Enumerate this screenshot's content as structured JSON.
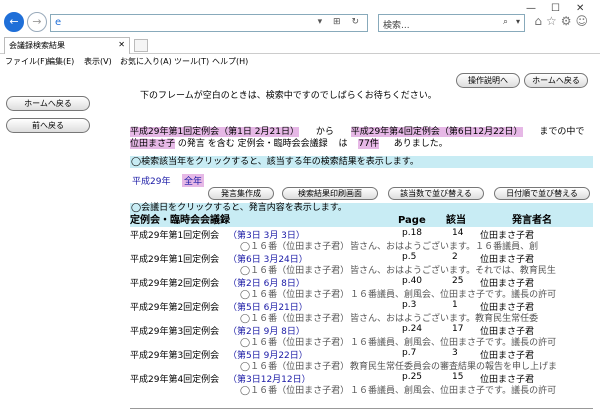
{
  "browser": {
    "search_placeholder": "検索...",
    "tab_title": "会議録検索結果",
    "menu": [
      "ファイル(F)",
      "編集(E)",
      "表示(V)",
      "お気に入り(A)",
      "ツール(T)",
      "ヘルプ(H)"
    ]
  },
  "buttons": {
    "home": "ホームへ戻る",
    "back": "前へ戻る",
    "help": "操作説明へ",
    "home_top": "ホームへ戻る",
    "speech_create": "発言集作成",
    "print": "検索結果印刷画面",
    "sort_by_no": "該当数で並び替える",
    "sort_by_date": "日付順で並び替える"
  },
  "notice": "下のフレームが空白のときは、検索中ですのでしばらくお待ちください。",
  "summary": {
    "range_from": "平成29年第1回定例会（第1日 2月21日）",
    "kara": "から",
    "range_to": "平成29年第4回定例会（第6日12月22日）",
    "made": "までの中で",
    "speaker": "位田まさ子",
    "text1": "の発言 を含む 定例会・臨時会会議録",
    "wa": "は",
    "count": "77件",
    "text2": "ありました。"
  },
  "year_bar": "◯検索該当年をクリックすると、該当する年の検索結果を表示します。",
  "year_links": [
    "平成29年",
    "全年"
  ],
  "day_bar": "◯会議日をクリックすると、発言内容を表示します。",
  "table": {
    "headers": [
      "定例会・臨時会会議録",
      "Page",
      "該当",
      "発言者名"
    ],
    "rows": [
      {
        "session": "平成29年第1回定例会",
        "date": "（第3日 3月 3日）",
        "page": "p.18",
        "no": "14",
        "speaker": "位田まさ子君",
        "who": "◯１６番（位田まさ子君）",
        "snippet": "皆さん、おはようございます。１６番議員、創"
      },
      {
        "session": "平成29年第1回定例会",
        "date": "（第6日 3月24日）",
        "page": "p.5",
        "no": "2",
        "speaker": "位田まさ子君",
        "who": "◯１６番（位田まさ子君）",
        "snippet": "皆さん、おはようございます。それでは、教育民生"
      },
      {
        "session": "平成29年第2回定例会",
        "date": "（第2日 6月 8日）",
        "page": "p.40",
        "no": "25",
        "speaker": "位田まさ子君",
        "who": "◯１６番（位田まさ子君）",
        "snippet": "１６番議員、創風会、位田まさ子です。議長の許可"
      },
      {
        "session": "平成29年第2回定例会",
        "date": "（第5日 6月21日）",
        "page": "p.3",
        "no": "1",
        "speaker": "位田まさ子君",
        "who": "◯１６番（位田まさ子君）",
        "snippet": "皆さん、おはようございます。教育民生常任委"
      },
      {
        "session": "平成29年第3回定例会",
        "date": "（第2日 9月 8日）",
        "page": "p.24",
        "no": "17",
        "speaker": "位田まさ子君",
        "who": "◯１６番（位田まさ子君）",
        "snippet": "１６番議員、創風会、位田まさ子です。議長の許可"
      },
      {
        "session": "平成29年第3回定例会",
        "date": "（第5日 9月22日）",
        "page": "p.7",
        "no": "3",
        "speaker": "位田まさ子君",
        "who": "◯１６番（位田まさ子君）",
        "snippet": "教育民生常任委員会の審査結果の報告を申し上げま"
      },
      {
        "session": "平成29年第4回定例会",
        "date": "（第3日12月12日）",
        "page": "p.25",
        "no": "15",
        "speaker": "位田まさ子君",
        "who": "◯１６番（位田まさ子君）",
        "snippet": "１６番議員、創風会、位田まさ子です。議長の許可"
      }
    ]
  }
}
